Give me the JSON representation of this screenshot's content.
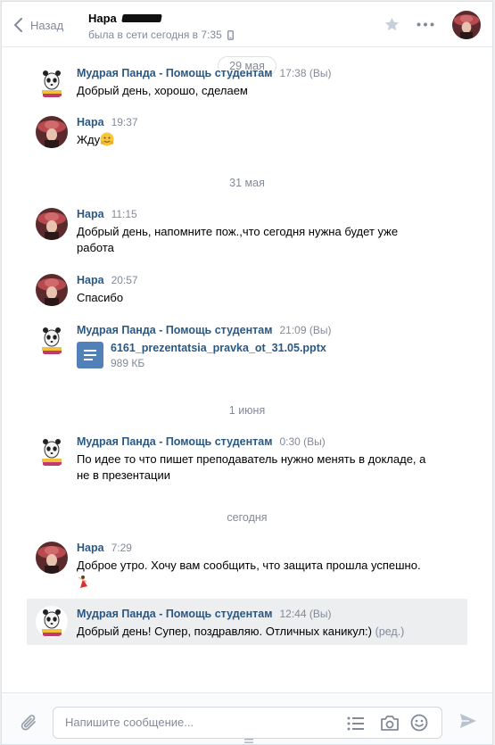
{
  "header": {
    "back_label": "Назад",
    "peer_name": "Нара",
    "peer_status": "была в сети сегодня в 7:35",
    "icons": [
      "chevron-left-icon",
      "mobile-icon",
      "star-icon",
      "more-icon"
    ]
  },
  "dates": [
    "29 мая",
    "31 мая",
    "1 июня",
    "сегодня"
  ],
  "messages": [
    {
      "author": "Мудрая Панда - Помощь студентам",
      "time": "17:38 (Вы)",
      "text": "Добрый день, хорошо, сделаем"
    },
    {
      "author": "Нара",
      "time": "19:37",
      "text": "Жду"
    },
    {
      "author": "Нара",
      "time": "11:15",
      "text": "Добрый день, напомните пож.,что сегодня нужна будет уже работа"
    },
    {
      "author": "Нара",
      "time": "20:57",
      "text": "Спасибо"
    },
    {
      "author": "Мудрая Панда - Помощь студентам",
      "time": "21:09 (Вы)",
      "file_name": "6161_prezentatsia_pravka_ot_31.05.pptx",
      "file_size": "989 КБ"
    },
    {
      "author": "Мудрая Панда - Помощь студентам",
      "time": "0:30 (Вы)",
      "text": "По идее то что пишет преподаватель нужно менять в докладе, а не в презентации"
    },
    {
      "author": "Нара",
      "time": "7:29",
      "text": "Доброе утро. Хочу вам сообщить, что защита прошла успешно."
    },
    {
      "author": "Мудрая Панда - Помощь студентам",
      "time": "12:44 (Вы)",
      "text": "Добрый день! Супер, поздравляю. Отличных каникул:)",
      "edited": "(ред.)"
    }
  ],
  "composer": {
    "placeholder": "Напишите сообщение...",
    "icons": [
      "paperclip-icon",
      "list-icon",
      "camera-icon",
      "smile-icon",
      "send-icon"
    ]
  },
  "colors": {
    "link": "#2a5885",
    "muted": "#828a99",
    "accent": "#5181b8",
    "selected_bg": "#edeef0"
  }
}
